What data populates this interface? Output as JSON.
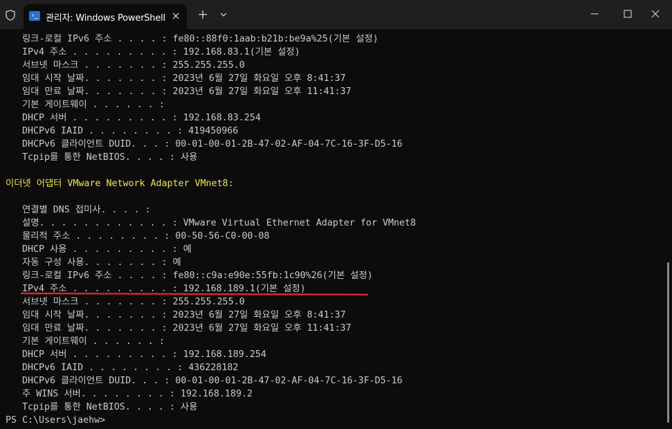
{
  "window": {
    "tab_title": "관리자: Windows PowerShell",
    "tab_icon_glyph": "›_"
  },
  "icons": {
    "shield": "shield-icon",
    "tab": "powershell-icon",
    "close_tab": "close-icon",
    "new_tab": "plus-icon",
    "dropdown": "chevron-down-icon",
    "minimize": "minimize-icon",
    "maximize": "maximize-icon",
    "close_window": "close-icon"
  },
  "colors": {
    "background": "#0c0c0c",
    "titlebar": "#1f1f1f",
    "text": "#cccccc",
    "adapter_heading": "#f0e64d",
    "annotation": "#e0262a",
    "tab_icon": "#2b6fd6"
  },
  "terminal": {
    "lines": [
      {
        "text": "   링크-로컬 IPv6 주소 . . . . : fe80::88f0:1aab:b21b:be9a%25(기본 설정)",
        "style": "normal"
      },
      {
        "text": "   IPv4 주소 . . . . . . . . . : 192.168.83.1(기본 설정)",
        "style": "normal"
      },
      {
        "text": "   서브넷 마스크 . . . . . . . : 255.255.255.0",
        "style": "normal"
      },
      {
        "text": "   임대 시작 날짜. . . . . . . : 2023년 6월 27일 화요일 오후 8:41:37",
        "style": "normal"
      },
      {
        "text": "   임대 만료 날짜. . . . . . . : 2023년 6월 27일 화요일 오후 11:41:37",
        "style": "normal"
      },
      {
        "text": "   기본 게이트웨이 . . . . . . :",
        "style": "normal"
      },
      {
        "text": "   DHCP 서버 . . . . . . . . . : 192.168.83.254",
        "style": "normal"
      },
      {
        "text": "   DHCPv6 IAID . . . . . . . . : 419450966",
        "style": "normal"
      },
      {
        "text": "   DHCPv6 클라이언트 DUID. . . : 00-01-00-01-2B-47-02-AF-04-7C-16-3F-D5-16",
        "style": "normal"
      },
      {
        "text": "   Tcpip를 통한 NetBIOS. . . . : 사용",
        "style": "normal"
      },
      {
        "text": "",
        "style": "normal"
      },
      {
        "text": "이더넷 어댑터 VMware Network Adapter VMnet8:",
        "style": "yellow"
      },
      {
        "text": "",
        "style": "normal"
      },
      {
        "text": "   연결별 DNS 접미사. . . . :",
        "style": "normal"
      },
      {
        "text": "   설명. . . . . . . . . . . . : VMware Virtual Ethernet Adapter for VMnet8",
        "style": "normal"
      },
      {
        "text": "   물리적 주소 . . . . . . . . : 00-50-56-C0-00-08",
        "style": "normal"
      },
      {
        "text": "   DHCP 사용 . . . . . . . . . : 예",
        "style": "normal"
      },
      {
        "text": "   자동 구성 사용. . . . . . . : 예",
        "style": "normal"
      },
      {
        "text": "   링크-로컬 IPv6 주소 . . . . : fe80::c9a:e90e:55fb:1c90%26(기본 설정)",
        "style": "normal"
      },
      {
        "text": "   IPv4 주소 . . . . . . . . . : 192.168.189.1(기본 설정)",
        "style": "normal"
      },
      {
        "text": "   서브넷 마스크 . . . . . . . : 255.255.255.0",
        "style": "normal"
      },
      {
        "text": "   임대 시작 날짜. . . . . . . : 2023년 6월 27일 화요일 오후 8:41:37",
        "style": "normal"
      },
      {
        "text": "   임대 만료 날짜. . . . . . . : 2023년 6월 27일 화요일 오후 11:41:37",
        "style": "normal"
      },
      {
        "text": "   기본 게이트웨이 . . . . . . :",
        "style": "normal"
      },
      {
        "text": "   DHCP 서버 . . . . . . . . . : 192.168.189.254",
        "style": "normal"
      },
      {
        "text": "   DHCPv6 IAID . . . . . . . . : 436228182",
        "style": "normal"
      },
      {
        "text": "   DHCPv6 클라이언트 DUID. . . : 00-01-00-01-2B-47-02-AF-04-7C-16-3F-D5-16",
        "style": "normal"
      },
      {
        "text": "   주 WINS 서버. . . . . . . . : 192.168.189.2",
        "style": "normal"
      },
      {
        "text": "   Tcpip를 통한 NetBIOS. . . . : 사용",
        "style": "normal"
      },
      {
        "text": "PS C:\\Users\\jaehw>",
        "style": "prompt"
      }
    ]
  }
}
